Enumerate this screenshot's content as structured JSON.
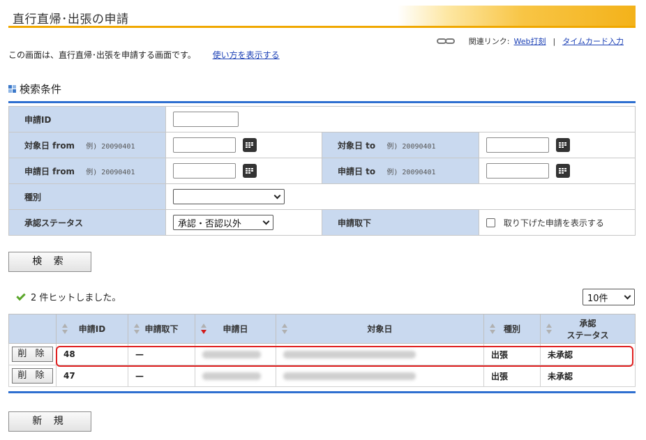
{
  "page": {
    "title": "直行直帰･出張の申請",
    "related_label": "関連リンク:",
    "related_links": [
      "Web打刻",
      "タイムカード入力"
    ],
    "related_sep": "|",
    "description": "この画面は、直行直帰･出張を申請する画面です。",
    "howto_link": "使い方を表示する"
  },
  "search": {
    "section_title": "検索条件",
    "application_id_label": "申請ID",
    "target_from_label": "対象日 from",
    "target_to_label": "対象日 to",
    "apply_from_label": "申請日 from",
    "apply_to_label": "申請日 to",
    "example": "例) 20090401",
    "type_label": "種別",
    "type_value": "",
    "status_label": "承認ステータス",
    "status_value": "承認・否認以外",
    "withdraw_label": "申請取下",
    "withdraw_checkbox_label": "取り下げた申請を表示する",
    "search_button": "検 索"
  },
  "results": {
    "hits_text": "2 件ヒットしました。",
    "page_size": "10件",
    "columns": {
      "id": "申請ID",
      "withdraw": "申請取下",
      "apply_date": "申請日",
      "target_date": "対象日",
      "type": "種別",
      "status_line1": "承認",
      "status_line2": "ステータス"
    },
    "delete_button": "削 除",
    "rows": [
      {
        "id": "48",
        "withdraw": "—",
        "type": "出張",
        "status": "未承認"
      },
      {
        "id": "47",
        "withdraw": "—",
        "type": "出張",
        "status": "未承認"
      }
    ],
    "new_button": "新 規"
  },
  "colors": {
    "accent_orange": "#f0a800",
    "header_blue": "#c9d9ef",
    "rule_blue": "#2e6fd0",
    "status_red": "#d20000",
    "highlight_red": "#e02020"
  }
}
